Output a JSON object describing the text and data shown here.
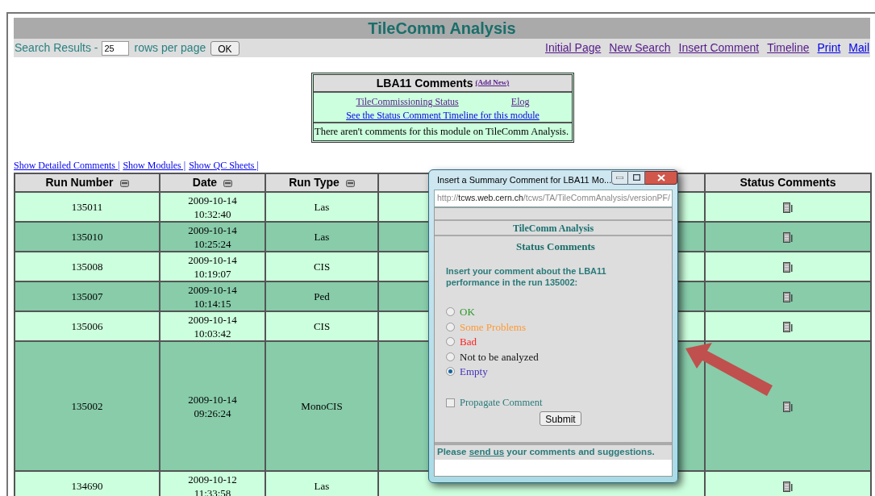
{
  "page_title": "TileComm Analysis",
  "toolbar": {
    "label_before": "Search Results -",
    "rows_value": "25",
    "label_after": "rows per page",
    "ok_button": "OK",
    "links": [
      {
        "label": "Initial Page",
        "visited": true
      },
      {
        "label": "New Search",
        "visited": true
      },
      {
        "label": "Insert Comment",
        "visited": true
      },
      {
        "label": "Timeline",
        "visited": true
      },
      {
        "label": "Print",
        "visited": false
      },
      {
        "label": "Mail",
        "visited": false
      }
    ]
  },
  "comments_box": {
    "title": "LBA11 Comments",
    "add_link": {
      "label": "(Add New)",
      "visited": true
    },
    "links": [
      {
        "label": "TileCommissioning Status",
        "visited": true
      },
      {
        "label": "Elog",
        "visited": true
      }
    ],
    "timeline_link": {
      "label": "See the Status Comment Timeline for this module",
      "visited": false
    },
    "message": "There aren't comments for this module on TileComm Analysis."
  },
  "view_links": [
    {
      "label": "Show Detailed Comments |",
      "visited": false
    },
    {
      "label": "Show Modules |",
      "visited": false
    },
    {
      "label": "Show QC Sheets |",
      "visited": false
    }
  ],
  "table": {
    "columns": [
      {
        "label": "Run Number",
        "sortable": true
      },
      {
        "label": "Date",
        "sortable": true
      },
      {
        "label": "Run Type",
        "sortable": true
      },
      {
        "label": "Status Comments",
        "sortable": false
      }
    ],
    "rows": [
      {
        "run": "135011",
        "date": "2009-10-14",
        "time": "10:32:40",
        "type": "Las"
      },
      {
        "run": "135010",
        "date": "2009-10-14",
        "time": "10:25:24",
        "type": "Las"
      },
      {
        "run": "135008",
        "date": "2009-10-14",
        "time": "10:19:07",
        "type": "CIS"
      },
      {
        "run": "135007",
        "date": "2009-10-14",
        "time": "10:14:15",
        "type": "Ped"
      },
      {
        "run": "135006",
        "date": "2009-10-14",
        "time": "10:03:42",
        "type": "CIS"
      },
      {
        "run": "135002",
        "date": "2009-10-14",
        "time": "09:26:24",
        "type": "MonoCIS"
      },
      {
        "run": "134690",
        "date": "2009-10-12",
        "time": "11:33:58",
        "type": "Las"
      }
    ]
  },
  "popup": {
    "title": "Insert a Summary Comment for LBA11 Mo...",
    "url": {
      "scheme": "http://",
      "host": "tcws.web.cern.ch",
      "path": "/tcws/TA/TileCommAnalysis/versionPF/"
    },
    "app_title": "TileComm Analysis",
    "heading": "Status Comments",
    "prompt": "Insert your comment about the LBA11 performance in the run 135002:",
    "options": [
      {
        "label": "OK",
        "color": "#2a9a2a",
        "selected": false
      },
      {
        "label": "Some Problems",
        "color": "#ff9933",
        "selected": false
      },
      {
        "label": "Bad",
        "color": "#ff2020",
        "selected": false
      },
      {
        "label": "Not to be analyzed",
        "color": "#111111",
        "selected": false
      },
      {
        "label": "Empty",
        "color": "#4433bb",
        "selected": true
      }
    ],
    "propagate": {
      "label": "Propagate Comment",
      "checked": false
    },
    "submit_button": "Submit",
    "footer": {
      "before": "Please",
      "link": "send us",
      "after": "your comments and suggestions."
    }
  }
}
